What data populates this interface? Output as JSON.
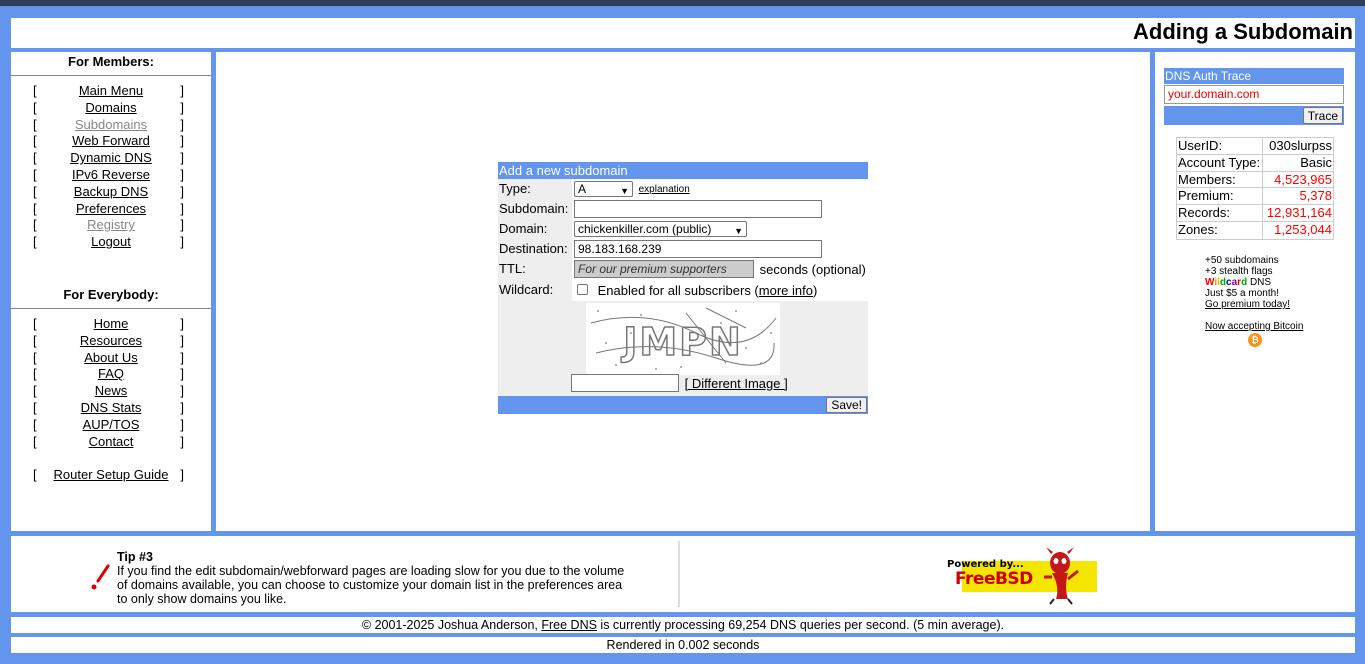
{
  "page_title": "Adding a Subdomain",
  "members_nav": {
    "heading": "For Members:",
    "items": [
      {
        "label": "Main Menu",
        "dim": false
      },
      {
        "label": "Domains",
        "dim": false
      },
      {
        "label": "Subdomains",
        "dim": true
      },
      {
        "label": "Web Forward",
        "dim": false
      },
      {
        "label": "Dynamic DNS",
        "dim": false
      },
      {
        "label": "IPv6 Reverse",
        "dim": false
      },
      {
        "label": "Backup DNS",
        "dim": false
      },
      {
        "label": "Preferences",
        "dim": false
      },
      {
        "label": "Registry",
        "dim": true
      },
      {
        "label": "Logout",
        "dim": false
      }
    ]
  },
  "everybody_nav": {
    "heading": "For Everybody:",
    "items": [
      "Home",
      "Resources",
      "About Us",
      "FAQ",
      "News",
      "DNS Stats",
      "AUP/TOS",
      "Contact"
    ],
    "extra": "Router Setup Guide"
  },
  "form": {
    "heading": "Add a new subdomain",
    "type_label": "Type:",
    "type_value": "A",
    "explanation_link": "explanation",
    "subdomain_label": "Subdomain:",
    "subdomain_value": "",
    "domain_label": "Domain:",
    "domain_value": "chickenkiller.com (public)",
    "destination_label": "Destination:",
    "destination_value": "98.183.168.239",
    "ttl_label": "TTL:",
    "ttl_placeholder": "For our premium supporters",
    "ttl_suffix": "seconds (optional)",
    "wildcard_label": "Wildcard:",
    "wildcard_text": "Enabled for all subscribers (",
    "wildcard_more": "more info",
    "wildcard_close": ")",
    "captcha_text": "JMPN",
    "captcha_value": "",
    "different_image": "[ Different Image ]",
    "save_label": "Save!"
  },
  "trace": {
    "heading": "DNS Auth Trace",
    "placeholder": "your.domain.com",
    "button": "Trace"
  },
  "stats": [
    {
      "label": "UserID:",
      "value": "030slurpss",
      "color": "#000000"
    },
    {
      "label": "Account Type:",
      "value": "Basic",
      "color": "#000000"
    },
    {
      "label": "Members:",
      "value": "4,523,965",
      "color": "#ff0000"
    },
    {
      "label": "Premium:",
      "value": "5,378",
      "color": "#ff0000"
    },
    {
      "label": "Records:",
      "value": "12,931,164",
      "color": "#ff0000"
    },
    {
      "label": "Zones:",
      "value": "1,253,044",
      "color": "#ff0000"
    }
  ],
  "promo": {
    "line1": "+50 subdomains",
    "line2": "+3 stealth flags",
    "wildcard_word": "Wildcard",
    "line3_suffix": " DNS",
    "line4": "Just $5 a month!",
    "link": "Go premium today!",
    "bitcoin": "Now accepting Bitcoin"
  },
  "tip": {
    "title": "Tip #3",
    "body": "If you find the edit subdomain/webforward pages are loading slow for you due to the volume of domains available, you can choose to customize your domain list in the preferences area to only show domains you like."
  },
  "powered": {
    "line1": "Powered by...",
    "line2": "FreeBSD"
  },
  "footer": {
    "prefix": "© 2001-2025 Joshua Anderson, ",
    "link": "Free DNS",
    "suffix": " is currently processing 69,254 DNS queries per second. (5 min average).",
    "rendered": "Rendered in 0.002 seconds"
  },
  "colors": {
    "accent": "#6495ed",
    "stat_red": "#ff0000",
    "topbar": "#2f3f55"
  }
}
